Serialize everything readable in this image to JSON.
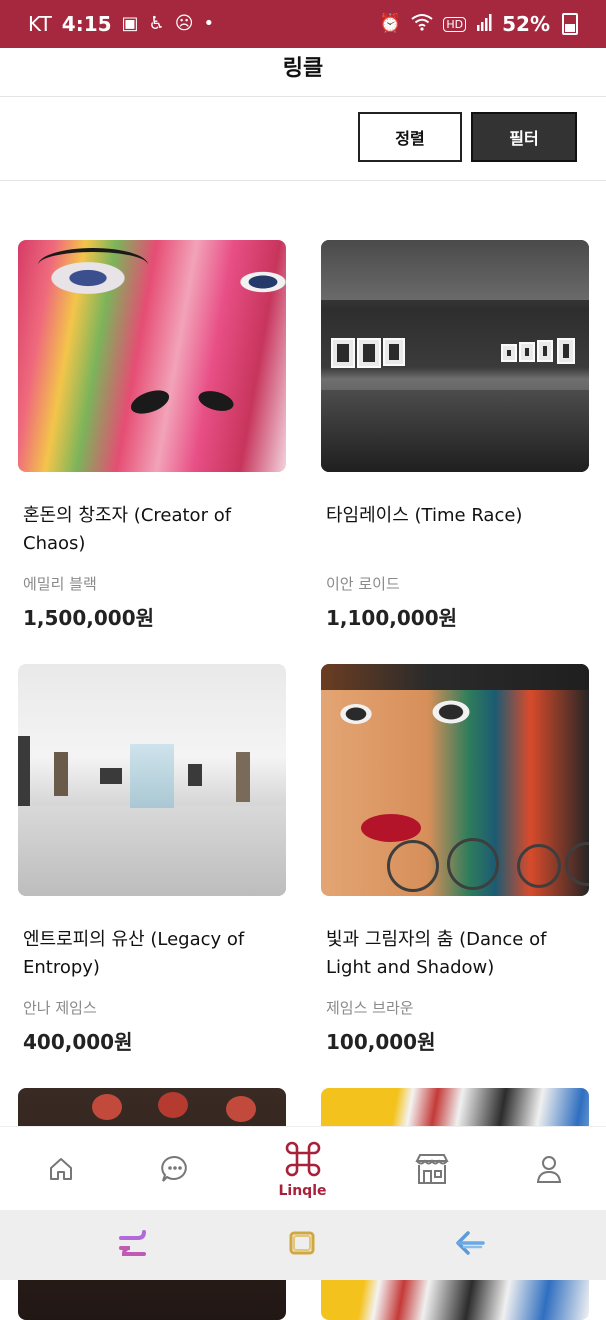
{
  "status_bar": {
    "carrier": "KT",
    "time": "4:15",
    "battery": "52%",
    "icons": [
      "gallery-icon",
      "accessibility-icon",
      "emoji-icon",
      "alarm-icon",
      "wifi-icon",
      "hd-icon",
      "signal-icon",
      "battery-icon"
    ]
  },
  "header": {
    "title": "링클"
  },
  "toolbar": {
    "sort_label": "정렬",
    "filter_label": "필터"
  },
  "products": [
    {
      "title": "혼돈의 창조자 (Creator of Chaos)",
      "artist": "에밀리 블랙",
      "price": "1,500,000원"
    },
    {
      "title": "타임레이스 (Time Race)",
      "artist": "이안 로이드",
      "price": "1,100,000원"
    },
    {
      "title": "엔트로피의 유산 (Legacy of Entropy)",
      "artist": "안나 제임스",
      "price": "400,000원"
    },
    {
      "title": "빛과 그림자의 춤 (Dance of Light and Shadow)",
      "artist": "제임스 브라운",
      "price": "100,000원"
    },
    {
      "title": "",
      "artist": "",
      "price": ""
    },
    {
      "title": "",
      "artist": "",
      "price": ""
    }
  ],
  "bottom_nav": {
    "items": [
      {
        "icon": "home-icon",
        "label": ""
      },
      {
        "icon": "chat-icon",
        "label": ""
      },
      {
        "icon": "command-icon",
        "label": "Linqle",
        "active": true
      },
      {
        "icon": "store-icon",
        "label": ""
      },
      {
        "icon": "profile-icon",
        "label": ""
      }
    ],
    "active_color": "#a8213a"
  },
  "system_nav": {
    "icons": [
      "recents-icon",
      "home-square-icon",
      "back-arrow-icon"
    ]
  },
  "colors": {
    "status_bar": "#a6283e",
    "accent": "#a8213a",
    "filter_button": "#333333"
  }
}
